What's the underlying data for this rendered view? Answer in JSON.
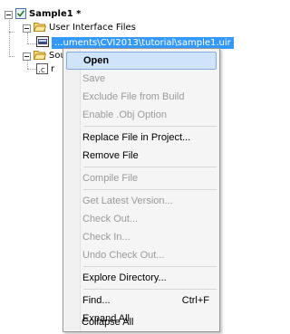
{
  "tree": {
    "root_label": "Sample1 *",
    "uir_folder_label": "User Interface Files",
    "uir_file_label": "...uments\\CVI2013\\tutorial\\sample1.uir",
    "source_folder_label_visible": "Sou",
    "c_file_label_visible": "r"
  },
  "context_menu": {
    "items": [
      {
        "label": "Open",
        "enabled": true
      },
      {
        "label": "Save",
        "enabled": false
      },
      {
        "label": "Exclude File from Build",
        "enabled": false
      },
      {
        "label": "Enable .Obj Option",
        "enabled": false
      },
      {
        "label": "Replace File in Project...",
        "enabled": true
      },
      {
        "label": "Remove File",
        "enabled": true
      },
      {
        "label": "Compile File",
        "enabled": false
      },
      {
        "label": "Get Latest Version...",
        "enabled": false
      },
      {
        "label": "Check Out...",
        "enabled": false
      },
      {
        "label": "Check In...",
        "enabled": false
      },
      {
        "label": "Undo Check Out...",
        "enabled": false
      },
      {
        "label": "Explore Directory...",
        "enabled": true
      },
      {
        "label": "Find...",
        "enabled": true,
        "shortcut": "Ctrl+F"
      },
      {
        "label": "Expand All",
        "enabled": true
      },
      {
        "label": "Collapse All",
        "enabled": true
      }
    ]
  },
  "colors": {
    "selection": "#3399ff",
    "menu_highlight": "#cfe4fb",
    "disabled_text": "#9a9a9a"
  }
}
